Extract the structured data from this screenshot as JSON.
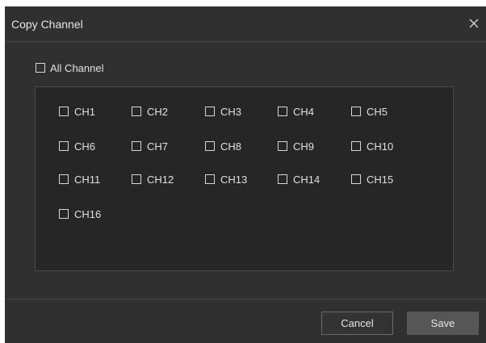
{
  "dialog": {
    "title": "Copy Channel",
    "close_icon": "close-icon"
  },
  "all_channel": {
    "label": "All Channel",
    "checked": false
  },
  "channels": [
    {
      "label": "CH1",
      "checked": false
    },
    {
      "label": "CH2",
      "checked": false
    },
    {
      "label": "CH3",
      "checked": false
    },
    {
      "label": "CH4",
      "checked": false
    },
    {
      "label": "CH5",
      "checked": false
    },
    {
      "label": "CH6",
      "checked": false
    },
    {
      "label": "CH7",
      "checked": false
    },
    {
      "label": "CH8",
      "checked": false
    },
    {
      "label": "CH9",
      "checked": false
    },
    {
      "label": "CH10",
      "checked": false
    },
    {
      "label": "CH11",
      "checked": false
    },
    {
      "label": "CH12",
      "checked": false
    },
    {
      "label": "CH13",
      "checked": false
    },
    {
      "label": "CH14",
      "checked": false
    },
    {
      "label": "CH15",
      "checked": false
    },
    {
      "label": "CH16",
      "checked": false
    }
  ],
  "footer": {
    "cancel_label": "Cancel",
    "save_label": "Save"
  },
  "colors": {
    "dialog_bg": "#303030",
    "panel_bg": "#262626",
    "text": "#e0e0e0",
    "save_bg": "#565656"
  }
}
